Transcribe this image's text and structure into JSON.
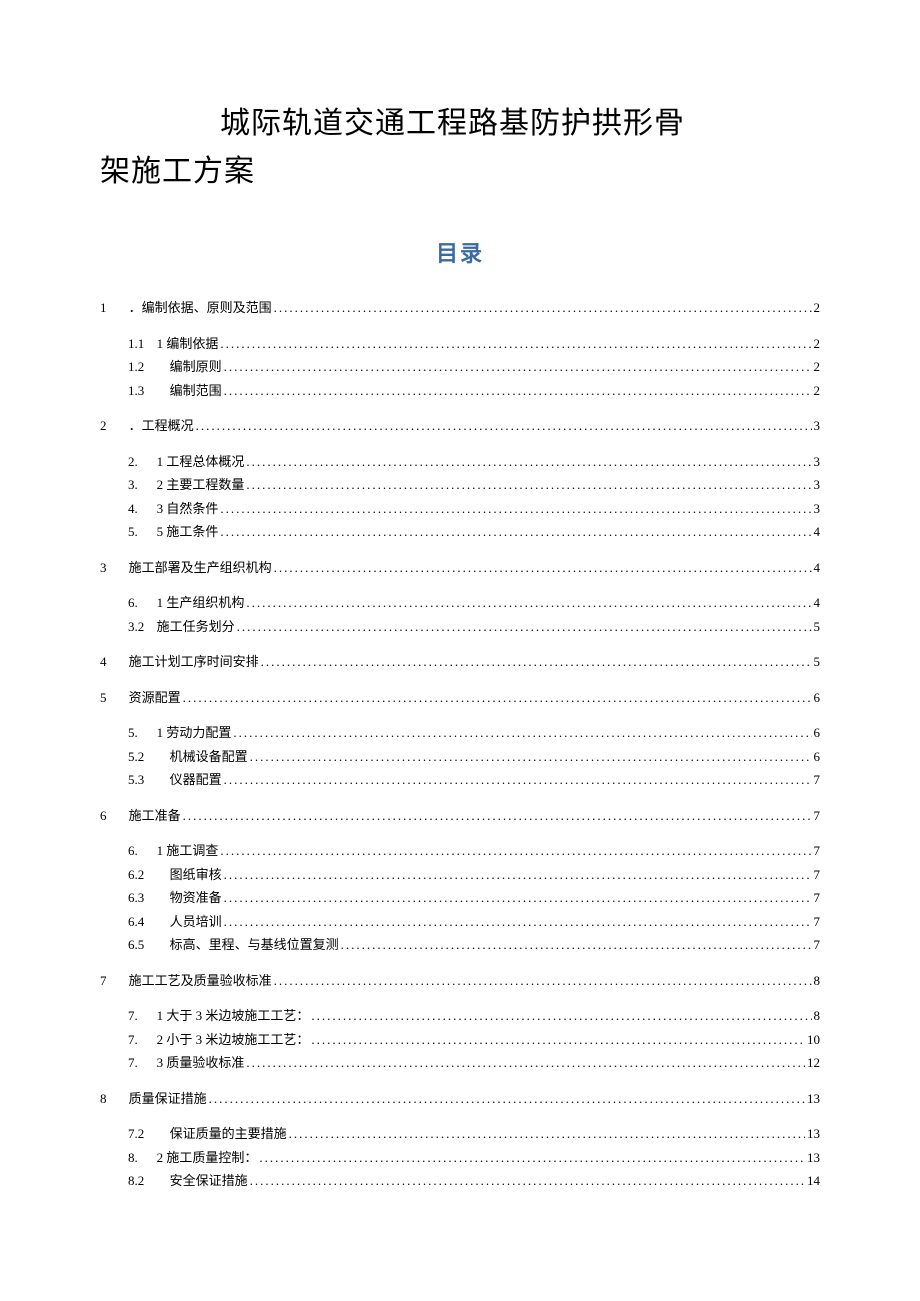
{
  "title": {
    "line1": "城际轨道交通工程路基防护拱形骨",
    "line2": "架施工方案"
  },
  "toc_heading": "目录",
  "toc": [
    {
      "level": 1,
      "num": "1",
      "text": "．编制依据、原则及范围",
      "page": "2"
    },
    {
      "level": 2,
      "num": "1.1",
      "text": "1 编制依据",
      "page": "2"
    },
    {
      "level": 2,
      "num": "1.2",
      "text": "　编制原则 ",
      "page": "2"
    },
    {
      "level": 2,
      "num": "1.3",
      "text": "　编制范围",
      "page": "2"
    },
    {
      "level": 1,
      "num": "2",
      "text": "．工程概况",
      "page": "3"
    },
    {
      "level": 2,
      "num": "2.",
      "text": "1 工程总体概况",
      "page": "3"
    },
    {
      "level": 2,
      "num": "3.",
      "text": "2 主要工程数量",
      "page": "3"
    },
    {
      "level": 2,
      "num": "4.",
      "text": "3 自然条件",
      "page": "3"
    },
    {
      "level": 2,
      "num": "5.",
      "text": "5 施工条件",
      "page": "4"
    },
    {
      "level": 1,
      "num": "3",
      "text": "施工部署及生产组织机构 ",
      "page": "4"
    },
    {
      "level": 2,
      "num": "6.",
      "text": "1 生产组织机构",
      "page": "4"
    },
    {
      "level": 2,
      "num": "3.2",
      "text": "施工任务划分 ",
      "page": "5"
    },
    {
      "level": 1,
      "num": "4",
      "text": "施工计划工序时间安排 ",
      "page": "5"
    },
    {
      "level": 1,
      "num": "5",
      "text": "资源配置 ",
      "page": "6"
    },
    {
      "level": 2,
      "num": "5.",
      "text": "1 劳动力配置",
      "page": "6"
    },
    {
      "level": 2,
      "num": "5.2",
      "text": "　机械设备配置 ",
      "page": "6"
    },
    {
      "level": 2,
      "num": "5.3",
      "text": "　仪器配置 ",
      "page": "7"
    },
    {
      "level": 1,
      "num": "6",
      "text": "施工准备 ",
      "page": "7"
    },
    {
      "level": 2,
      "num": "6.",
      "text": "1 施工调查",
      "page": "7"
    },
    {
      "level": 2,
      "num": "6.2",
      "text": "　图纸审核 ",
      "page": "7"
    },
    {
      "level": 2,
      "num": "6.3",
      "text": "　物资准备 ",
      "page": "7"
    },
    {
      "level": 2,
      "num": "6.4",
      "text": "　人员培训 ",
      "page": "7"
    },
    {
      "level": 2,
      "num": "6.5",
      "text": "　标高、里程、与基线位置复测 ",
      "page": "7"
    },
    {
      "level": 1,
      "num": "7",
      "text": "施工工艺及质量验收标准 ",
      "page": "8"
    },
    {
      "level": 2,
      "num": "7.",
      "text": "1 大于 3 米边坡施工工艺：",
      "page": "8"
    },
    {
      "level": 2,
      "num": "7.",
      "text": "2 小于 3 米边坡施工工艺：",
      "page": "10"
    },
    {
      "level": 2,
      "num": "7.",
      "text": "3 质量验收标准",
      "page": "12"
    },
    {
      "level": 1,
      "num": "8",
      "text": "质量保证措施 ",
      "page": "13"
    },
    {
      "level": 2,
      "num": "7.2",
      "text": "　保证质量的主要措施",
      "page": "13"
    },
    {
      "level": 2,
      "num": "8.",
      "text": "2 施工质量控制：",
      "page": "13"
    },
    {
      "level": 2,
      "num": "8.2",
      "text": "　安全保证措施 ",
      "page": "14"
    }
  ]
}
